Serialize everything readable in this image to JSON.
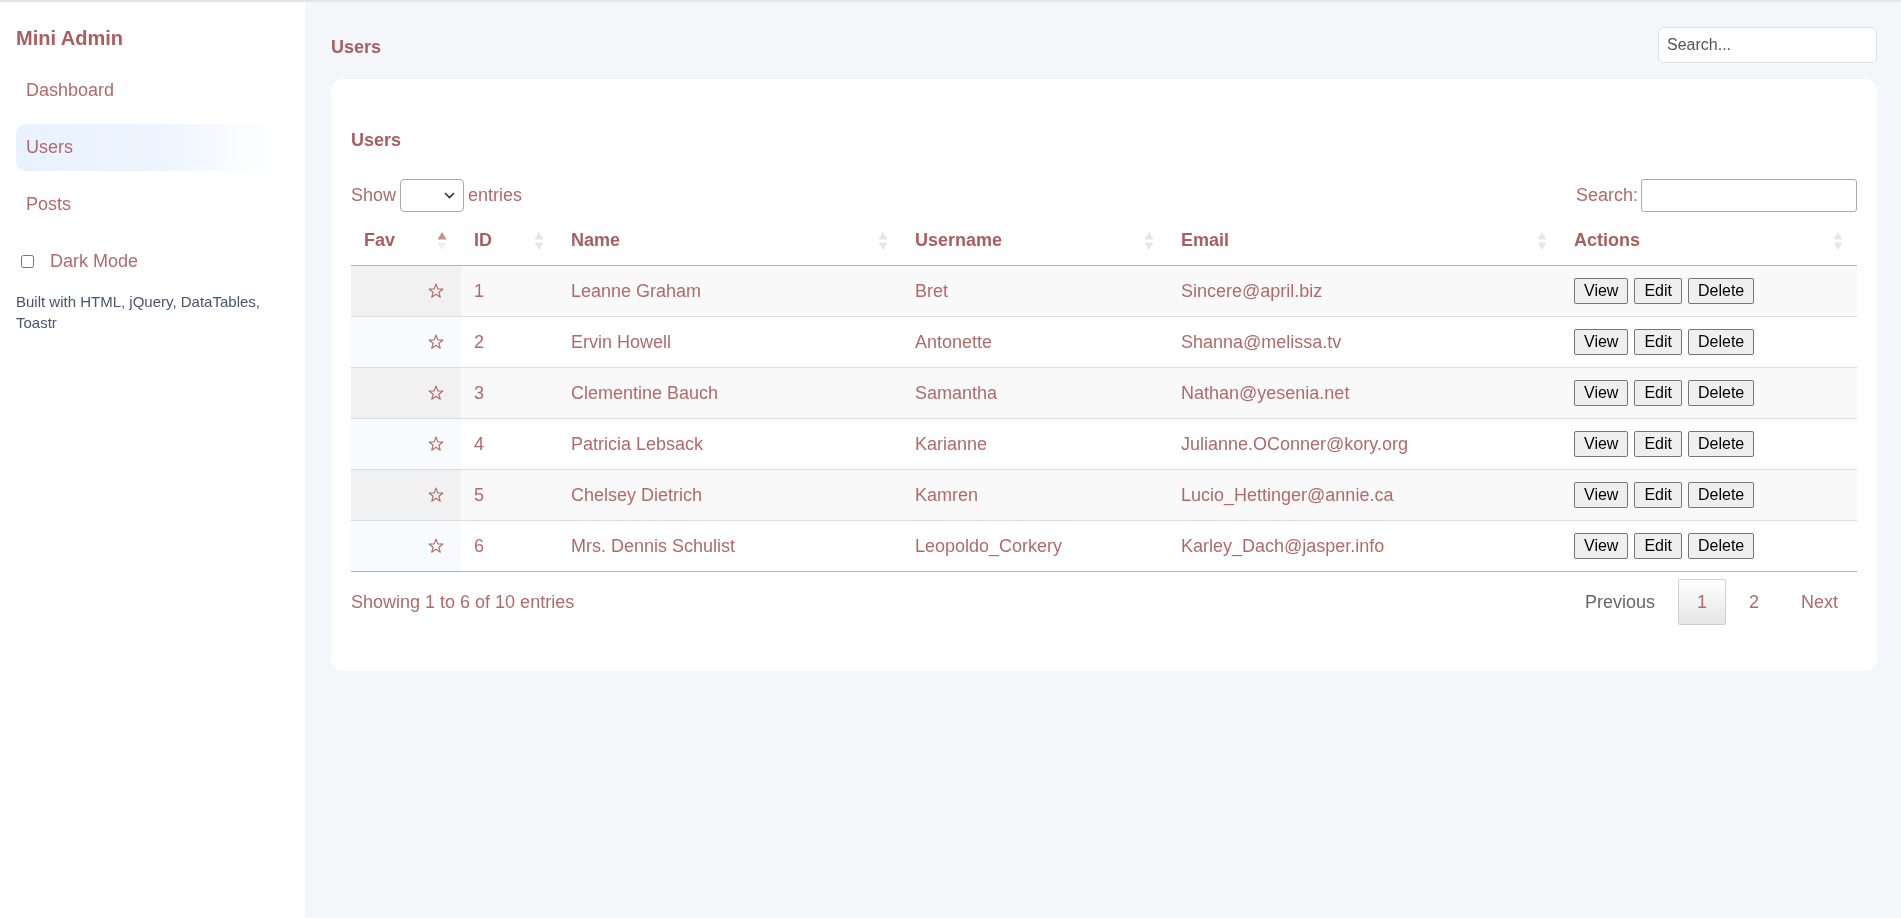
{
  "sidebar": {
    "brand": "Mini Admin",
    "items": [
      {
        "label": "Dashboard",
        "selected": false
      },
      {
        "label": "Users",
        "selected": true
      },
      {
        "label": "Posts",
        "selected": false
      }
    ],
    "dark_mode": {
      "label": "Dark Mode",
      "checked": false
    },
    "footer": "Built with HTML, jQuery, DataTables, Toastr"
  },
  "header": {
    "title": "Users",
    "search": {
      "placeholder": "Search..."
    }
  },
  "card": {
    "title": "Users",
    "length_menu": {
      "label_before": "Show",
      "label_after": "entries"
    },
    "search_label": "Search:",
    "table": {
      "columns": [
        {
          "label": "Fav",
          "sorted": true
        },
        {
          "label": "ID",
          "sorted": false
        },
        {
          "label": "Name",
          "sorted": false
        },
        {
          "label": "Username",
          "sorted": false
        },
        {
          "label": "Email",
          "sorted": false
        },
        {
          "label": "Actions",
          "sorted": false
        }
      ],
      "rows": [
        {
          "favorite": false,
          "id": "1",
          "name": "Leanne Graham",
          "username": "Bret",
          "email": "Sincere@april.biz",
          "actions": [
            "View",
            "Edit",
            "Delete"
          ]
        },
        {
          "favorite": false,
          "id": "2",
          "name": "Ervin Howell",
          "username": "Antonette",
          "email": "Shanna@melissa.tv",
          "actions": [
            "View",
            "Edit",
            "Delete"
          ]
        },
        {
          "favorite": false,
          "id": "3",
          "name": "Clementine Bauch",
          "username": "Samantha",
          "email": "Nathan@yesenia.net",
          "actions": [
            "View",
            "Edit",
            "Delete"
          ]
        },
        {
          "favorite": false,
          "id": "4",
          "name": "Patricia Lebsack",
          "username": "Karianne",
          "email": "Julianne.OConner@kory.org",
          "actions": [
            "View",
            "Edit",
            "Delete"
          ]
        },
        {
          "favorite": false,
          "id": "5",
          "name": "Chelsey Dietrich",
          "username": "Kamren",
          "email": "Lucio_Hettinger@annie.ca",
          "actions": [
            "View",
            "Edit",
            "Delete"
          ]
        },
        {
          "favorite": false,
          "id": "6",
          "name": "Mrs. Dennis Schulist",
          "username": "Leopoldo_Corkery",
          "email": "Karley_Dach@jasper.info",
          "actions": [
            "View",
            "Edit",
            "Delete"
          ]
        }
      ]
    },
    "info": "Showing 1 to 6 of 10 entries",
    "pagination": {
      "previous": {
        "label": "Previous",
        "disabled": true
      },
      "pages": [
        {
          "label": "1",
          "selected": true
        },
        {
          "label": "2",
          "selected": false
        }
      ],
      "next": {
        "label": "Next",
        "disabled": false
      }
    }
  }
}
